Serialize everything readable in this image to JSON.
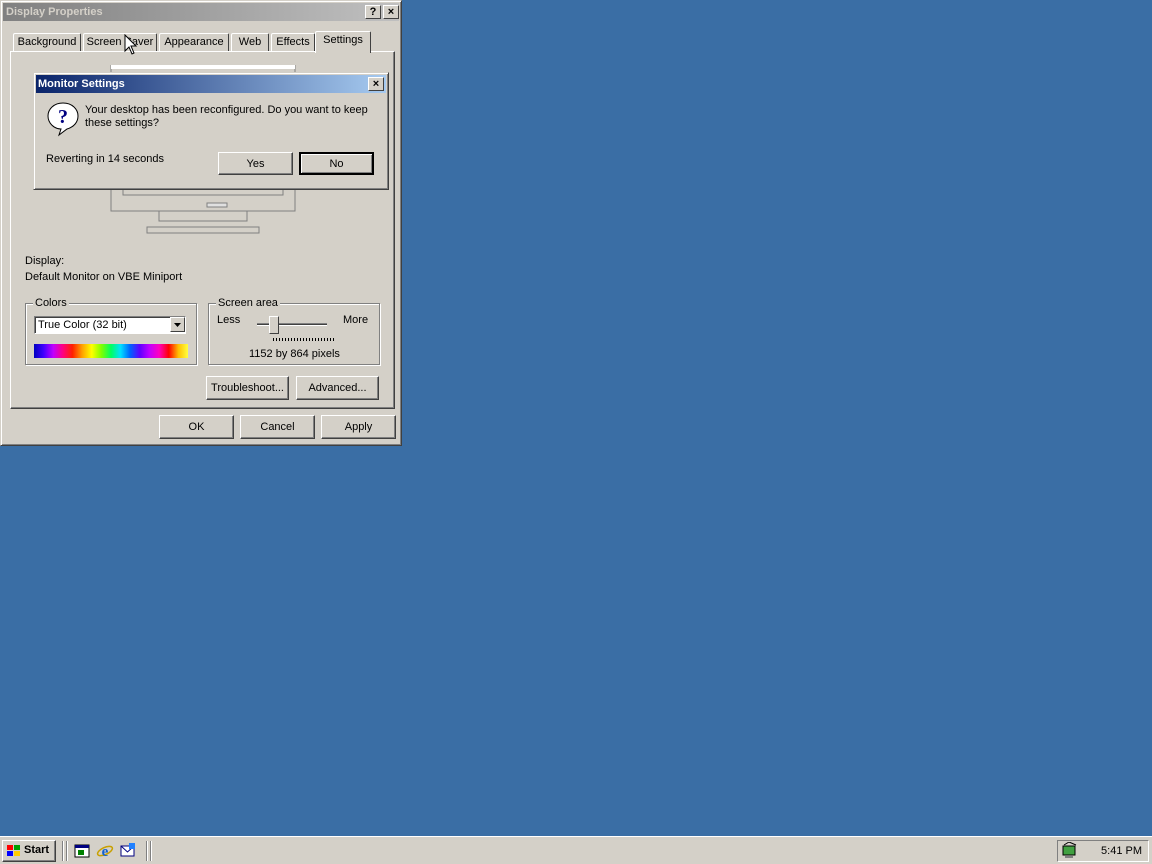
{
  "display_properties": {
    "title": "Display Properties",
    "help_button": "?",
    "close_button": "×",
    "tabs": [
      {
        "label": "Background"
      },
      {
        "label": "Screen Saver"
      },
      {
        "label": "Appearance"
      },
      {
        "label": "Web"
      },
      {
        "label": "Effects"
      },
      {
        "label": "Settings",
        "active": true
      }
    ],
    "display_label": "Display:",
    "display_value": "Default Monitor on VBE Miniport",
    "colors": {
      "group_title": "Colors",
      "selected": "True Color (32 bit)"
    },
    "screen_area": {
      "group_title": "Screen area",
      "less_label": "Less",
      "more_label": "More",
      "value_text": "1152 by 864 pixels",
      "slider_level": 0.2
    },
    "troubleshoot_label": "Troubleshoot...",
    "advanced_label": "Advanced...",
    "ok_label": "OK",
    "cancel_label": "Cancel",
    "apply_label": "Apply"
  },
  "monitor_settings": {
    "title": "Monitor Settings",
    "close_button": "×",
    "message": "Your desktop has been reconfigured.  Do you want to keep these settings?",
    "countdown": "Reverting in 14 seconds",
    "yes_label": "Yes",
    "no_label": "No",
    "icon": "question-icon"
  },
  "taskbar": {
    "start_label": "Start",
    "clock": "5:41 PM",
    "quick_launch": [
      "show-desktop-icon",
      "internet-explorer-icon",
      "outlook-express-icon"
    ]
  },
  "colors": {
    "desktop": "#3a6ea5",
    "face": "#d4d0c8",
    "active_title_start": "#0a246a",
    "active_title_end": "#a6caf0",
    "inactive_title": "#808080"
  }
}
